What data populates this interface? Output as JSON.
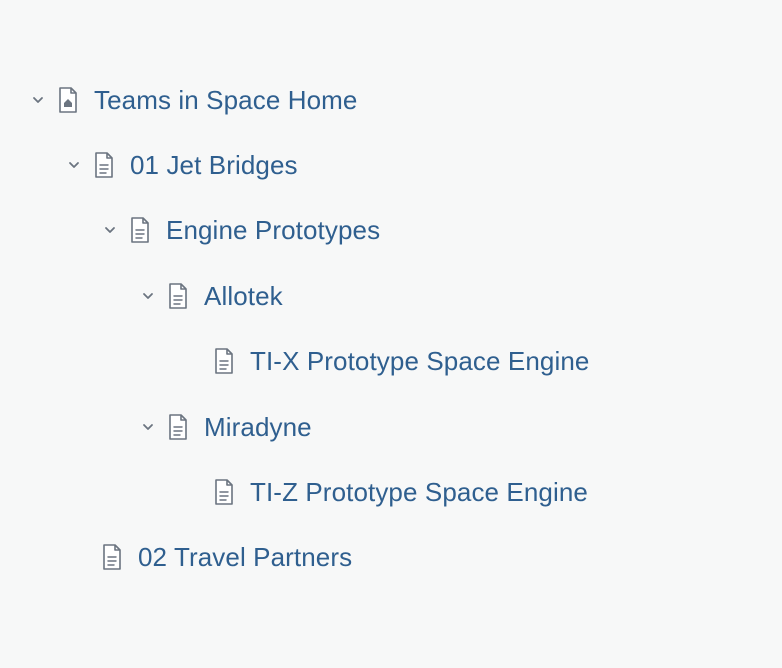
{
  "page_tree": {
    "items": [
      {
        "label": "Teams in Space Home",
        "icon": "home-page-icon",
        "expanded": true,
        "depth": 0
      },
      {
        "label": "01 Jet Bridges",
        "icon": "page-icon",
        "expanded": true,
        "depth": 1
      },
      {
        "label": "Engine Prototypes",
        "icon": "page-icon",
        "expanded": true,
        "depth": 2
      },
      {
        "label": "Allotek",
        "icon": "page-icon",
        "expanded": true,
        "depth": 3
      },
      {
        "label": "TI-X Prototype Space Engine",
        "icon": "page-icon",
        "expanded": false,
        "depth": 4
      },
      {
        "label": "Miradyne",
        "icon": "page-icon",
        "expanded": true,
        "depth": 3
      },
      {
        "label": "TI-Z Prototype Space Engine",
        "icon": "page-icon",
        "expanded": false,
        "depth": 4
      },
      {
        "label": "02 Travel Partners",
        "icon": "page-icon",
        "expanded": false,
        "depth": 1
      }
    ]
  },
  "colors": {
    "background": "#f7f8f8",
    "link": "#2f5f8f",
    "icon": "#6b7480"
  }
}
